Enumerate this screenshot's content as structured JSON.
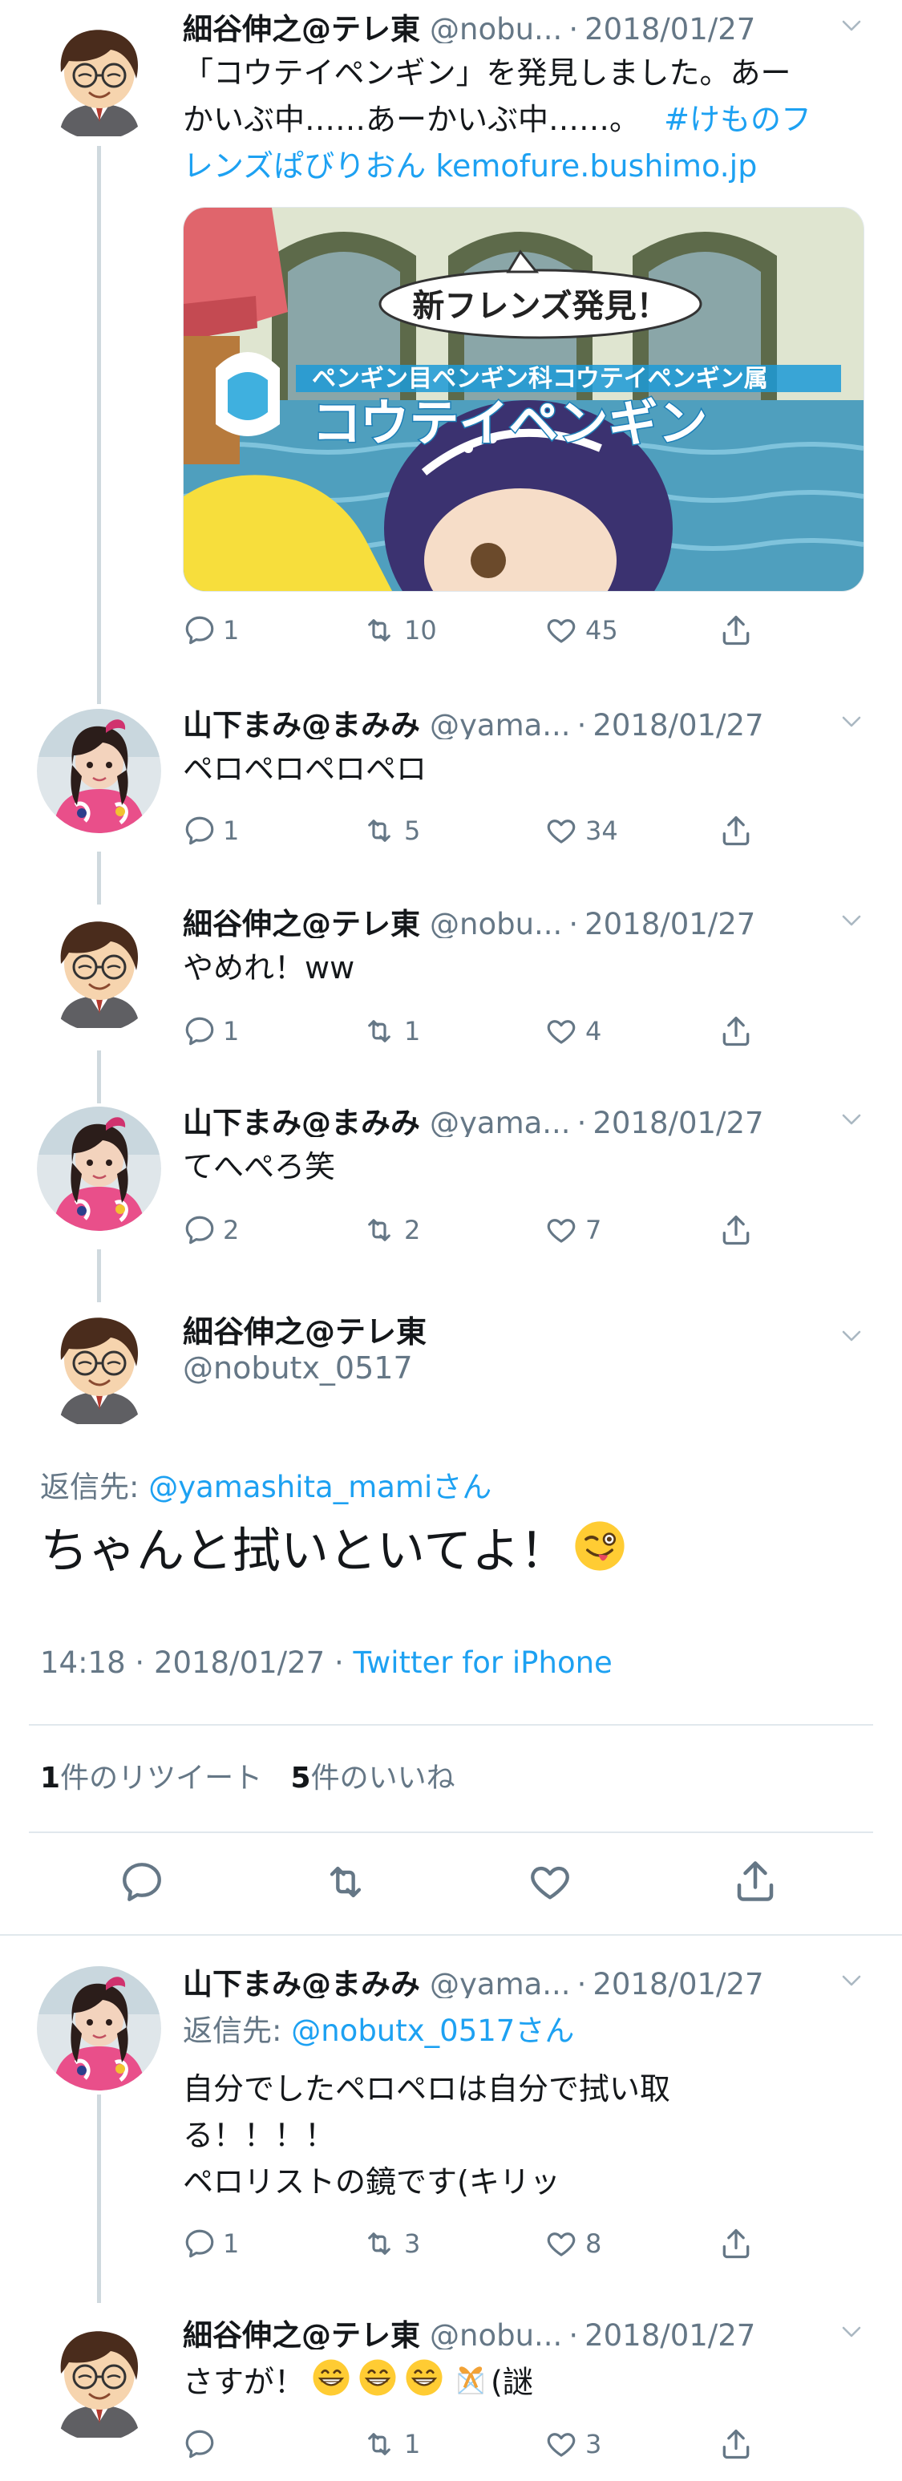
{
  "tweets": [
    {
      "name": "細谷伸之@テレ東",
      "handle": "@nobu...",
      "date": "2018/01/27",
      "line1": "「コウテイペンギン」を発見しました。あー",
      "line2_a": "かいぶ中……あーかいぶ中……。",
      "line2_hashtag": "#けものフ",
      "line3_hashtag": "レンズぱびりおん",
      "line3_link": "kemofure.bushimo.jp",
      "card": {
        "banner": "新フレンズ発見！",
        "subtitle": "ペンギン目ペンギン科コウテイペンギン属",
        "title": "コウテイペンギン"
      },
      "replies": "1",
      "retweets": "10",
      "likes": "45"
    },
    {
      "name": "山下まみ@まみみ",
      "handle": "@yama...",
      "date": "2018/01/27",
      "text": "ペロペロペロペロ",
      "replies": "1",
      "retweets": "5",
      "likes": "34"
    },
    {
      "name": "細谷伸之@テレ東",
      "handle": "@nobu...",
      "date": "2018/01/27",
      "text": "やめれ！ww",
      "replies": "1",
      "retweets": "1",
      "likes": "4"
    },
    {
      "name": "山下まみ@まみみ",
      "handle": "@yama...",
      "date": "2018/01/27",
      "text": "てへぺろ笑",
      "replies": "2",
      "retweets": "2",
      "likes": "7"
    }
  ],
  "focused": {
    "name": "細谷伸之@テレ東",
    "handle": "@nobutx_0517",
    "reply_to_label": "返信先:",
    "reply_to_user": "@yamashita_mamiさん",
    "text": "ちゃんと拭いといてよ！",
    "time": "14:18",
    "date": "2018/01/27",
    "via": "Twitter for iPhone",
    "retweet_count": "1",
    "retweet_label": "件のリツイート",
    "like_count": "5",
    "like_label": "件のいいね"
  },
  "replies_below": [
    {
      "name": "山下まみ@まみみ",
      "handle": "@yama...",
      "date": "2018/01/27",
      "reply_to_label": "返信先:",
      "reply_to_user": "@nobutx_0517さん",
      "line1": "自分でしたペロペロは自分で拭い取",
      "line2": "る！！！！",
      "line3": "ペロリストの鏡です(キリッ",
      "replies": "1",
      "retweets": "3",
      "likes": "8"
    },
    {
      "name": "細谷伸之@テレ東",
      "handle": "@nobu...",
      "date": "2018/01/27",
      "text_a": "さすが！",
      "text_b": "(謎",
      "retweets": "1",
      "likes": "3"
    }
  ],
  "colors": {
    "accent": "#1da1f2",
    "muted": "#657786",
    "text": "#14171a",
    "line": "#cfd9de"
  }
}
